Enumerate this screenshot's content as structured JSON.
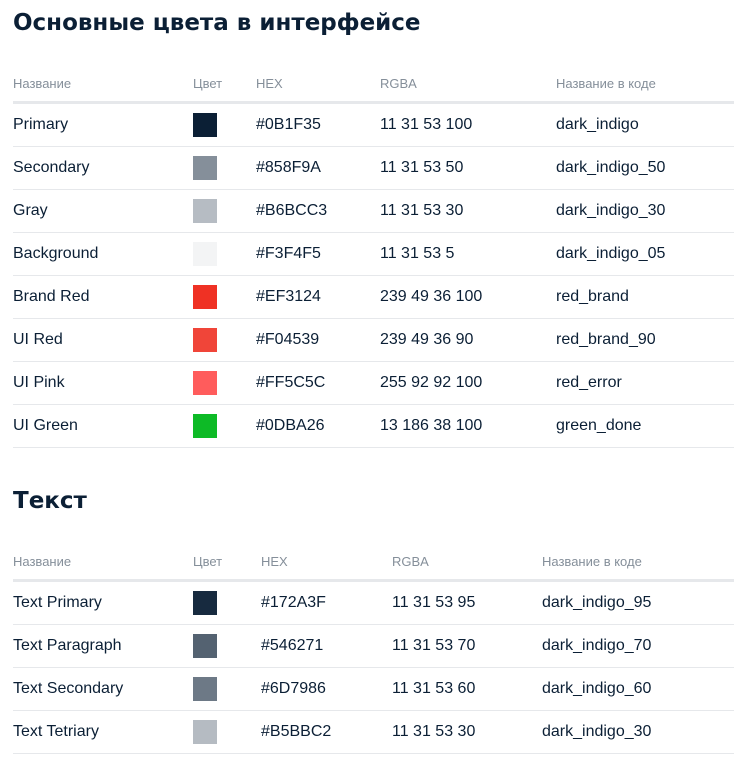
{
  "section1": {
    "title": "Основные цвета в интерфейсе",
    "headers": [
      "Название",
      "Цвет",
      "HEX",
      "RGBA",
      "Название в коде"
    ],
    "rows": [
      {
        "name": "Primary",
        "color": "#0B1F35",
        "hex": "#0B1F35",
        "rgba": "11 31 53 100",
        "code": "dark_indigo"
      },
      {
        "name": "Secondary",
        "color": "#858F9A",
        "hex": "#858F9A",
        "rgba": "11 31 53 50",
        "code": "dark_indigo_50"
      },
      {
        "name": "Gray",
        "color": "#B6BCC3",
        "hex": "#B6BCC3",
        "rgba": "11 31 53 30",
        "code": "dark_indigo_30"
      },
      {
        "name": "Background",
        "color": "#F3F4F5",
        "hex": "#F3F4F5",
        "rgba": "11 31 53 5",
        "code": "dark_indigo_05"
      },
      {
        "name": "Brand Red",
        "color": "#EF3124",
        "hex": "#EF3124",
        "rgba": "239 49 36 100",
        "code": "red_brand"
      },
      {
        "name": "UI Red",
        "color": "#F04539",
        "hex": "#F04539",
        "rgba": "239 49 36 90",
        "code": "red_brand_90"
      },
      {
        "name": "UI Pink",
        "color": "#FF5C5C",
        "hex": "#FF5C5C",
        "rgba": "255 92 92 100",
        "code": "red_error"
      },
      {
        "name": "UI Green",
        "color": "#0DBA26",
        "hex": "#0DBA26",
        "rgba": "13 186 38 100",
        "code": "green_done"
      }
    ]
  },
  "section2": {
    "title": "Текст",
    "headers": [
      "Название",
      "Цвет",
      "HEX",
      "RGBA",
      "Название в коде"
    ],
    "rows": [
      {
        "name": "Text Primary",
        "color": "#172A3F",
        "hex": "#172A3F",
        "rgba": "11 31 53 95",
        "code": "dark_indigo_95"
      },
      {
        "name": "Text Paragraph",
        "color": "#546271",
        "hex": "#546271",
        "rgba": "11 31 53 70",
        "code": "dark_indigo_70"
      },
      {
        "name": "Text Secondary",
        "color": "#6D7986",
        "hex": "#6D7986",
        "rgba": "11 31 53 60",
        "code": "dark_indigo_60"
      },
      {
        "name": "Text Tetriary",
        "color": "#B5BBC2",
        "hex": "#B5BBC2",
        "rgba": "11 31 53 30",
        "code": "dark_indigo_30"
      }
    ]
  }
}
